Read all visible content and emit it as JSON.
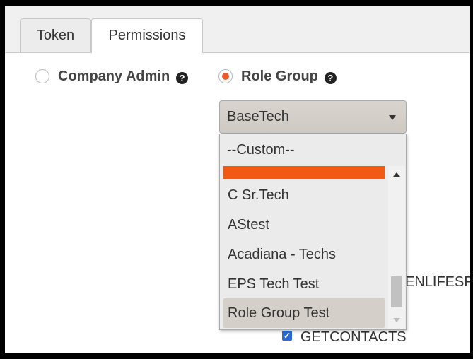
{
  "tabs": [
    {
      "label": "Token"
    },
    {
      "label": "Permissions"
    }
  ],
  "access_options": [
    {
      "label": "Company Admin",
      "checked": false,
      "help_icon": "question-circle-icon"
    },
    {
      "label": "Role Group",
      "checked": true,
      "help_icon": "question-circle-icon"
    }
  ],
  "role_group_select": {
    "value": "BaseTech",
    "options": [
      {
        "label": "--Custom--"
      },
      {
        "label": "C Sr.Tech"
      },
      {
        "label": "AStest"
      },
      {
        "label": "Acadiana - Techs"
      },
      {
        "label": "EPS Tech Test"
      },
      {
        "label": "Role Group Test"
      }
    ],
    "selected_option": "Role Group Test"
  },
  "background": {
    "partial_permission_text": "ENLIFESF",
    "permission_item": "GETCONTACTS",
    "permission_checked": true
  },
  "colors": {
    "accent": "#f05a28",
    "checkbox": "#2a6bd6"
  }
}
